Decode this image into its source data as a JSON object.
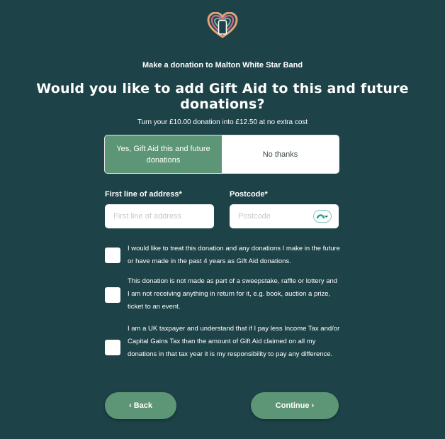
{
  "header": {
    "logo_icon": "rainbow-heart-phone-icon",
    "subtitle": "Make a donation to Malton White Star Band",
    "title": "Would you like to add Gift Aid to this and future donations?",
    "offer": "Turn your £10.00 donation into £12.50 at no extra cost"
  },
  "gift_aid_toggle": {
    "yes_label": "Yes, Gift Aid this and future donations",
    "no_label": "No thanks",
    "selected": "yes"
  },
  "address": {
    "label": "First line of address*",
    "placeholder": "First line of address",
    "value": ""
  },
  "postcode": {
    "label": "Postcode*",
    "placeholder": "Postcode",
    "value": "",
    "lookup_icon": "postcode-lookup-icon"
  },
  "declarations": [
    {
      "checked": false,
      "text": "I would like to treat this donation and any donations I make in the future or have made in the past 4 years as Gift Aid donations."
    },
    {
      "checked": false,
      "text": "This donation is not made as part of a sweepstake, raffle or lottery and I am not receiving anything in return for it, e.g. book, auction a prize, ticket to an event."
    },
    {
      "checked": false,
      "text": "I am a UK taxpayer and understand that if I pay less Income Tax and/or Capital Gains Tax than the amount of Gift Aid claimed on all my donations in that tax year it is my responsibility to pay any difference."
    }
  ],
  "nav": {
    "back_label": "‹ Back",
    "continue_label": "Continue ›"
  },
  "colors": {
    "background": "#1d4247",
    "accent": "#5d9676",
    "white": "#ffffff"
  }
}
